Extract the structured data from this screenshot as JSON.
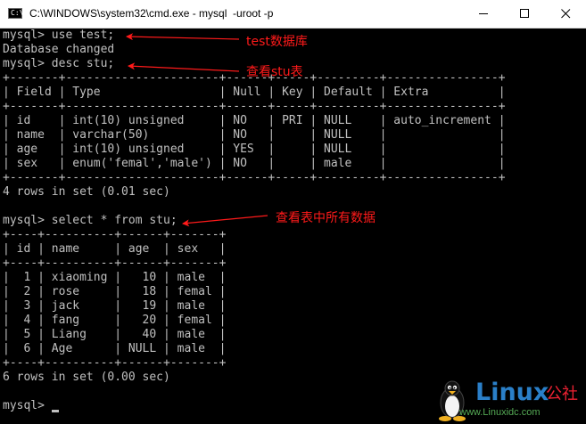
{
  "window": {
    "title": "C:\\WINDOWS\\system32\\cmd.exe - mysql  -uroot -p",
    "icon": "cmd-prompt-icon",
    "icon_text": "C:\\"
  },
  "console": {
    "lines": [
      "mysql> use test;",
      "Database changed",
      "mysql> desc stu;",
      "+-------+----------------------+------+-----+---------+----------------+",
      "| Field | Type                 | Null | Key | Default | Extra          |",
      "+-------+----------------------+------+-----+---------+----------------+",
      "| id    | int(10) unsigned     | NO   | PRI | NULL    | auto_increment |",
      "| name  | varchar(50)          | NO   |     | NULL    |                |",
      "| age   | int(10) unsigned     | YES  |     | NULL    |                |",
      "| sex   | enum('femal','male') | NO   |     | male    |                |",
      "+-------+----------------------+------+-----+---------+----------------+",
      "4 rows in set (0.01 sec)",
      "",
      "mysql> select * from stu;",
      "+----+----------+------+-------+",
      "| id | name     | age  | sex   |",
      "+----+----------+------+-------+",
      "|  1 | xiaoming |   10 | male  |",
      "|  2 | rose     |   18 | femal |",
      "|  3 | jack     |   19 | male  |",
      "|  4 | fang     |   20 | femal |",
      "|  5 | Liang    |   40 | male  |",
      "|  6 | Age      | NULL | male  |",
      "+----+----------+------+-------+",
      "6 rows in set (0.00 sec)",
      "",
      "mysql> "
    ]
  },
  "annotations": [
    "test数据库",
    "查看stu表",
    "查看表中所有数据"
  ],
  "watermark": {
    "logo": "Linux",
    "suffix": "公社",
    "url": "www.Linuxidc.com"
  },
  "colors": {
    "console_bg": "#000000",
    "console_fg": "#c0c0c0",
    "annotation": "#ff1a1a"
  }
}
